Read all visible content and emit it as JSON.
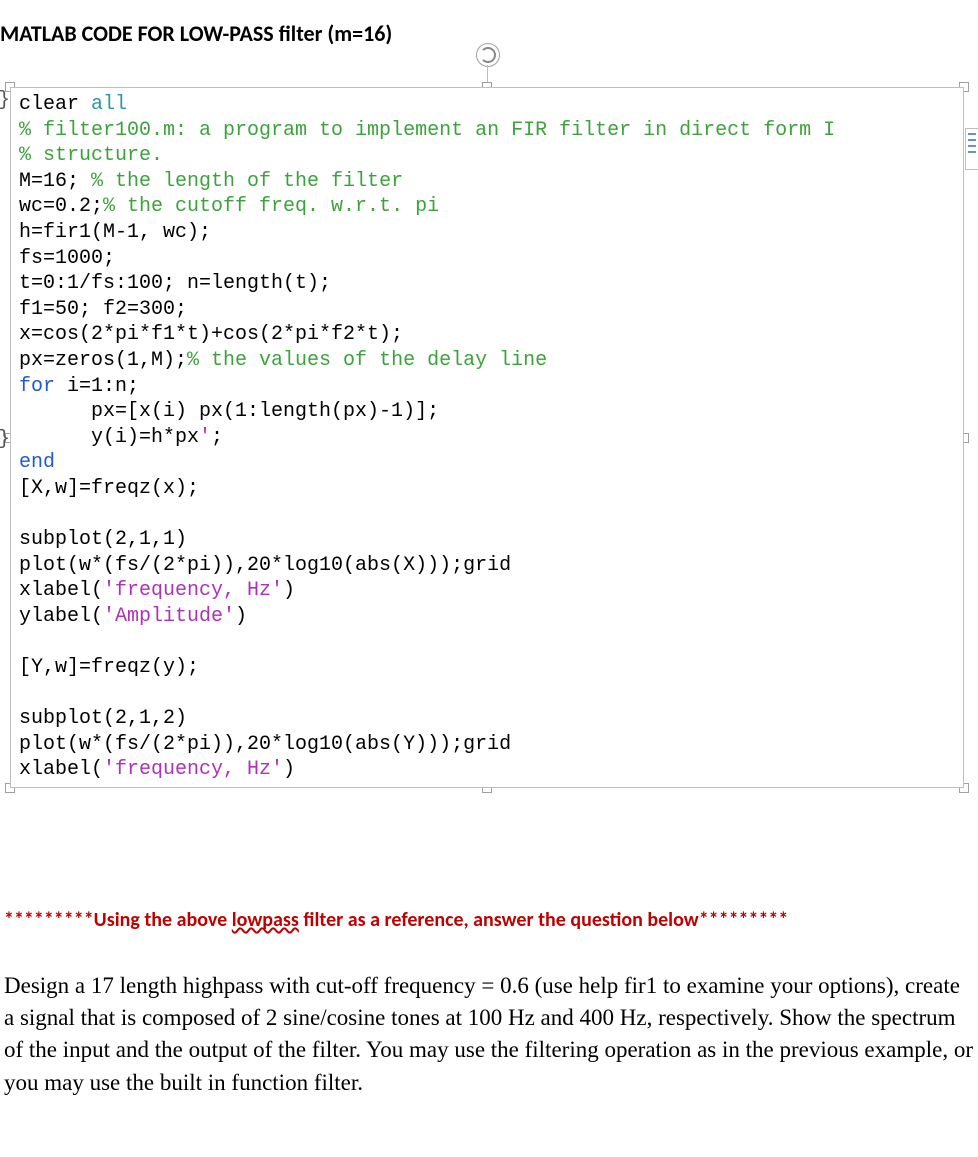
{
  "heading": "MATLAB CODE FOR LOW-PASS filter (m=16)",
  "code": {
    "l1_a": "clear ",
    "l1_b": "all",
    "l2": "% filter100.m: a program to implement an FIR filter in direct form I",
    "l3": "% structure.",
    "l4_a": "M=16; ",
    "l4_b": "% the length of the filter",
    "l5_a": "wc=0.2;",
    "l5_b": "% the cutoff freq. w.r.t. pi",
    "l6": "h=fir1(M-1, wc);",
    "l7": "fs=1000;",
    "l8": "t=0:1/fs:100; n=length(t);",
    "l9": "f1=50; f2=300;",
    "l10": "x=cos(2*pi*f1*t)+cos(2*pi*f2*t);",
    "l11_a": "px=zeros(1,M);",
    "l11_b": "% the values of the delay line",
    "l12_a": "for ",
    "l12_b": "i=1:n;",
    "l13": "      px=[x(i) px(1:length(px)-1)];",
    "l14_a": "      y(i)=h*px",
    "l14_b": "'",
    "l14_c": ";",
    "l15": "end",
    "l16": "[X,w]=freqz(x);",
    "l17": "",
    "l18": "subplot(2,1,1)",
    "l19_a": "plot(w*(fs/(2*pi)),20*log10(abs(X)));grid",
    "l20_a": "xlabel(",
    "l20_b": "'frequency, Hz'",
    "l20_c": ")",
    "l21_a": "ylabel(",
    "l21_b": "'Amplitude'",
    "l21_c": ")",
    "l22": "",
    "l23": "[Y,w]=freqz(y);",
    "l24": "",
    "l25": "subplot(2,1,2)",
    "l26": "plot(w*(fs/(2*pi)),20*log10(abs(Y)));grid",
    "l27_a": "xlabel(",
    "l27_b": "'frequency, Hz'",
    "l27_c": ")"
  },
  "refline": {
    "stars_left": "*********",
    "text_a": "Using the above ",
    "text_b": "lowpass",
    "text_c": " filter as a reference, answer the question below",
    "stars_right": "*********"
  },
  "question": "Design a 17 length highpass with cut-off frequency = 0.6 (use help fir1 to examine your options), create a signal that is composed of 2 sine/cosine tones at 100 Hz and 400 Hz, respectively. Show the spectrum of the input and the output of the filter. You may use the filtering operation as in the previous example, or you may use the built in function filter."
}
